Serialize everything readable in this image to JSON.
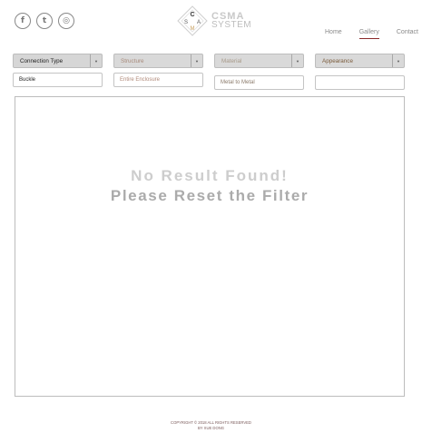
{
  "social": {
    "facebook": "f",
    "twitter": "t",
    "instagram": "◎",
    "icons": [
      "facebook-icon",
      "twitter-icon",
      "instagram-icon"
    ]
  },
  "logo": {
    "letters": [
      "C",
      "S",
      "A",
      "M"
    ],
    "line1": "CSMA",
    "line2": "SYSTEM"
  },
  "nav": {
    "items": [
      {
        "label": "Home"
      },
      {
        "label": "Gallery"
      },
      {
        "label": "Contact"
      }
    ],
    "active": "Gallery",
    "accent": "#8a2a2a"
  },
  "filters": [
    {
      "select_label": "Connection Type",
      "value": "Buckle"
    },
    {
      "select_label": "Structure",
      "value": "Entire Enclosure"
    },
    {
      "select_label": "Material",
      "value": "Metal to Metal"
    },
    {
      "select_label": "Appearance",
      "value": ""
    }
  ],
  "results": {
    "line1": "No Result Found!",
    "line2": "Please Reset the Filter"
  },
  "footer": {
    "line1": "COPYRIGHT © 2018 ALL RIGHTS RESERVED",
    "line2": "BY XUE DONG"
  }
}
